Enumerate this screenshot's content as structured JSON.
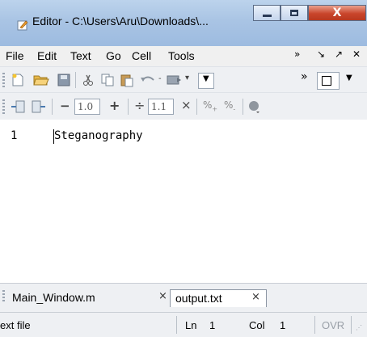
{
  "window": {
    "title": "Editor - C:\\Users\\Aru\\Downloads\\...",
    "controls": {
      "minimize": "—",
      "maximize": "□",
      "close": "X"
    }
  },
  "menubar": {
    "items": [
      "File",
      "Edit",
      "Text",
      "Go",
      "Cell",
      "Tools"
    ],
    "overflow": "»",
    "dock": "↘",
    "undock": "↗",
    "close": "✕"
  },
  "toolbar1": {
    "icons": [
      "new-file-icon",
      "open-folder-icon",
      "save-icon",
      "cut-icon",
      "copy-icon",
      "paste-icon",
      "undo-icon",
      "redo-icon",
      "dropdown-icon",
      "overflow-icon",
      "stop-icon"
    ]
  },
  "toolbar2": {
    "decrement": "−",
    "value1": "1.0",
    "increment": "+",
    "divide": "÷",
    "value2": "1.1",
    "multiply": "×",
    "comment_icon": "comment-icon",
    "uncomment_icon": "uncomment-icon",
    "breakpoint_icon": "breakpoint-icon"
  },
  "editor": {
    "lines": [
      {
        "number": "1",
        "text": "Steganography"
      }
    ]
  },
  "tabs": [
    {
      "label": "Main_Window.m",
      "close": "×",
      "active": false
    },
    {
      "label": "output.txt",
      "close": "×",
      "active": true
    }
  ],
  "statusbar": {
    "file_type": "ext file",
    "line_label": "Ln",
    "line_value": "1",
    "col_label": "Col",
    "col_value": "1",
    "mode": "OVR"
  }
}
